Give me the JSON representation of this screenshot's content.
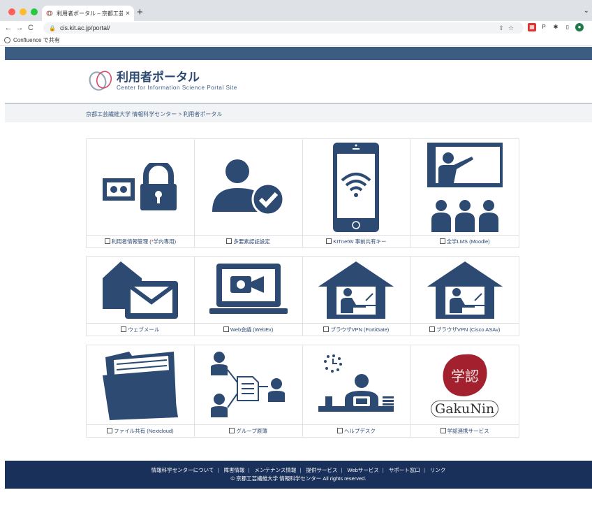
{
  "browser": {
    "tab_title": "利用者ポータル – 京都工芸繊維大学",
    "tab_close": "×",
    "new_tab": "+",
    "url": "cis.kit.ac.jp/portal/",
    "bookmark": "Confluence で共有"
  },
  "header": {
    "title": "利用者ポータル",
    "subtitle": "Center for Information Science Portal Site"
  },
  "breadcrumb": "京都工芸繊維大学 情報科学センター > 利用者ポータル",
  "tiles": [
    {
      "label": "利用者情報管理 (",
      "mark": "*",
      "label_after": "学内専用)",
      "icon": "lock-card-icon"
    },
    {
      "label": "多要素認証設定",
      "icon": "user-check-icon"
    },
    {
      "label": "KITnetW 事前共有キー",
      "icon": "phone-wifi-icon"
    },
    {
      "label": "全学LMS (Moodle)",
      "icon": "classroom-icon"
    },
    {
      "label": "ウェブメール",
      "icon": "mail-icon"
    },
    {
      "label": "Web会議 (WebEx)",
      "icon": "laptop-video-icon"
    },
    {
      "label": "ブラウザVPN (FortiGate)",
      "icon": "home-work-icon"
    },
    {
      "label": "ブラウザVPN (Cisco ASAv)",
      "icon": "home-work-icon"
    },
    {
      "label": "ファイル共有 (Nextcloud)",
      "icon": "folder-icon"
    },
    {
      "label": "グループ原簿",
      "icon": "group-doc-icon"
    },
    {
      "label": "ヘルプデスク",
      "icon": "helpdesk-icon"
    },
    {
      "label": "学認連携サービス",
      "icon": "gakunin-logo"
    }
  ],
  "gakunin": {
    "seal": "学認",
    "wordmark": "GakuNin"
  },
  "footer": {
    "links": [
      "情報科学センターについて",
      "障害情報",
      "メンテナンス情報",
      "提供サービス",
      "Webサービス",
      "サポート窓口",
      "リンク"
    ],
    "separator": "|",
    "copyright": "© 京都工芸繊維大学 情報科学センター All rights reserved."
  },
  "colors": {
    "brand": "#2d4a73",
    "topbar": "#3d5c82",
    "footer": "#19305a",
    "accent_red": "#d63030",
    "seal_red": "#a3202e"
  }
}
